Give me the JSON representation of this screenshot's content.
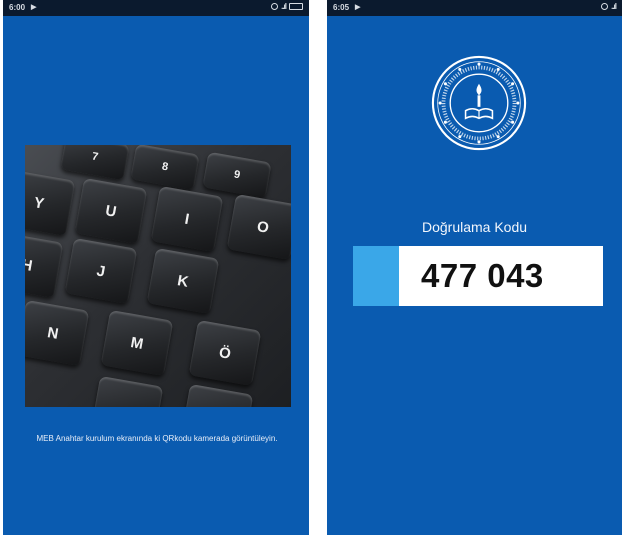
{
  "left_screen": {
    "status": {
      "time": "6:00",
      "icons_text": "..ıl"
    },
    "instruction": "MEB Anahtar kurulum ekranında ki QRkodu kamerada görüntüleyin.",
    "keys": [
      "7",
      "8",
      "9",
      "Y",
      "U",
      "I",
      "O",
      "H",
      "J",
      "K",
      "N",
      "M",
      "Ö"
    ]
  },
  "right_screen": {
    "status": {
      "time": "6:05",
      "icons_text": "..ıl"
    },
    "code_label": "Doğrulama Kodu",
    "code_value": "477 043"
  },
  "colors": {
    "background_blue": "#0a5bb0",
    "accent_light_blue": "#3aa7e8",
    "status_bar": "#0b1a2e"
  }
}
